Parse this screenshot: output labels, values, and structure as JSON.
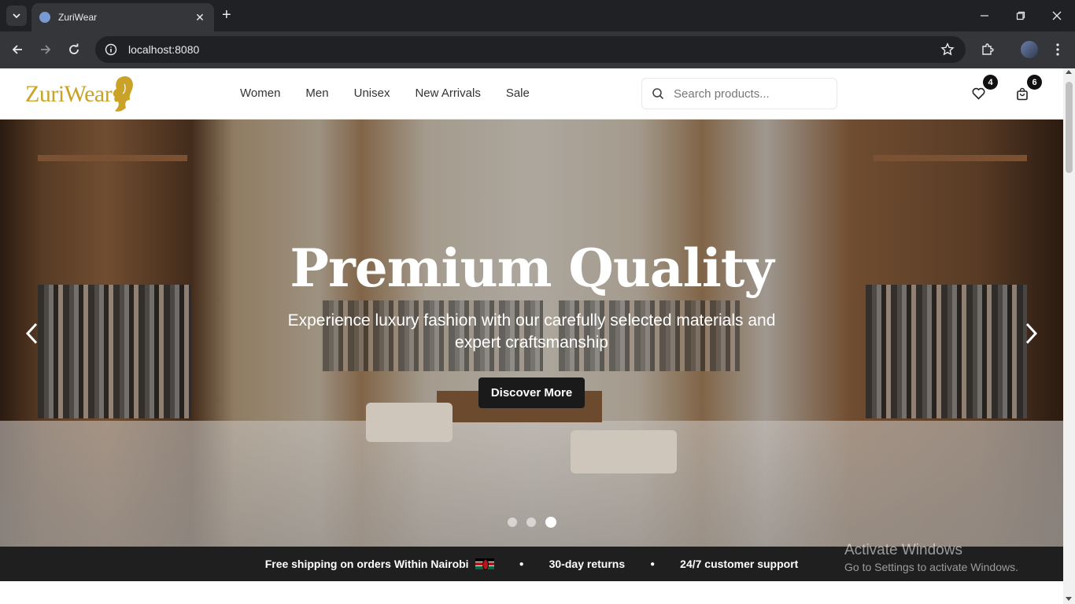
{
  "browser": {
    "tab_title": "ZuriWear",
    "url": "localhost:8080"
  },
  "site": {
    "logo_text": "ZuriWear",
    "nav": [
      "Women",
      "Men",
      "Unisex",
      "New Arrivals",
      "Sale"
    ],
    "search_placeholder": "Search products...",
    "wishlist_count": "4",
    "cart_count": "6"
  },
  "hero": {
    "title": "Premium Quality",
    "subtitle": "Experience luxury fashion with our carefully selected materials and expert craftsmanship",
    "cta": "Discover More",
    "slides": 3,
    "active_slide": 3
  },
  "promo": {
    "shipping": "Free shipping on orders Within Nairobi",
    "returns": "30-day returns",
    "support": "24/7 customer support"
  },
  "watermark": {
    "line1": "Activate Windows",
    "line2": "Go to Settings to activate Windows."
  },
  "colors": {
    "brand_gold": "#c9a227",
    "promo_bg": "#1f1f1f",
    "cta_bg": "#1a1a1a"
  }
}
